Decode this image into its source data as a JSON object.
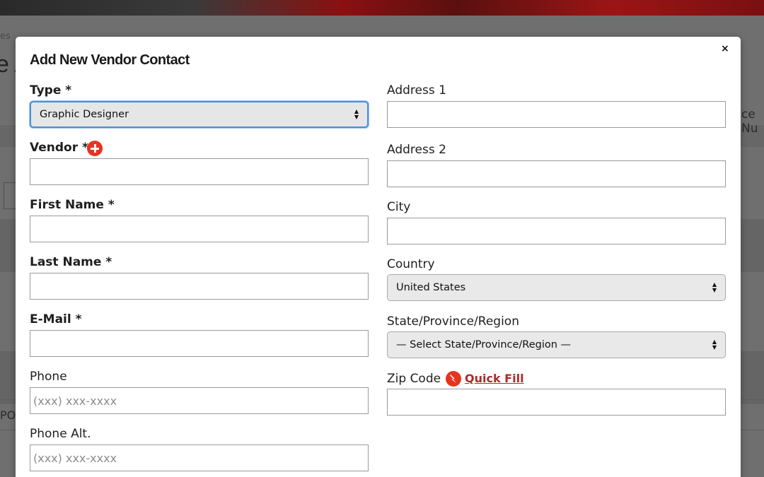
{
  "background": {
    "crumb": "es",
    "title": "e A",
    "right_fragment": "ce Nu",
    "left_fragment": "PO"
  },
  "modal": {
    "title": "Add New Vendor Contact",
    "close_label": "×"
  },
  "left_column": {
    "type": {
      "label": "Type *",
      "value": "Graphic Designer"
    },
    "vendor": {
      "label": "Vendor *",
      "value": ""
    },
    "first_name": {
      "label": "First Name *",
      "value": ""
    },
    "last_name": {
      "label": "Last Name *",
      "value": ""
    },
    "email": {
      "label": "E-Mail *",
      "value": ""
    },
    "phone": {
      "label": "Phone",
      "placeholder": "(xxx) xxx-xxxx"
    },
    "phone_alt": {
      "label": "Phone Alt.",
      "placeholder": "(xxx) xxx-xxxx"
    }
  },
  "right_column": {
    "address1": {
      "label": "Address 1",
      "value": ""
    },
    "address2": {
      "label": "Address 2",
      "value": ""
    },
    "city": {
      "label": "City",
      "value": ""
    },
    "country": {
      "label": "Country",
      "value": "United States"
    },
    "state": {
      "label": "State/Province/Region",
      "value": "— Select State/Province/Region —"
    },
    "zip": {
      "label": "Zip Code",
      "value": "",
      "quick_fill": "Quick Fill"
    }
  },
  "icons": {
    "add_vendor": "plus-circle-icon",
    "quick_fill": "lightning-bolt-icon",
    "select_arrows": "up-down-arrows-icon"
  },
  "colors": {
    "accent_red": "#e5341f",
    "link_red": "#b02a2a",
    "focus_blue": "#4a90e2"
  }
}
